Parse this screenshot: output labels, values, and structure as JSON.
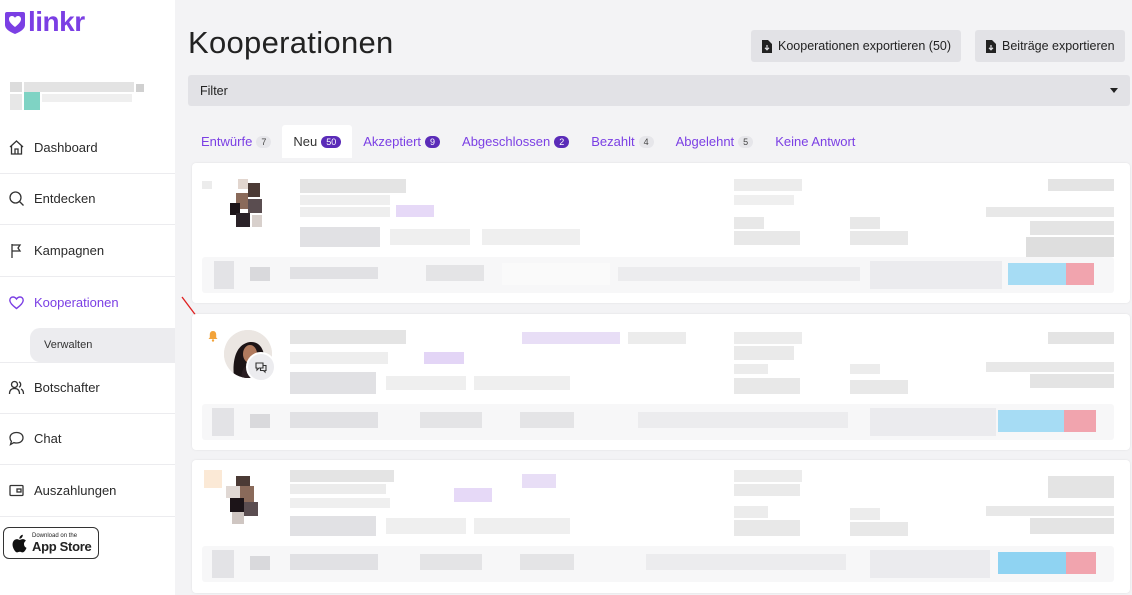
{
  "brand": {
    "name": "linkr",
    "color": "#7b3fe4"
  },
  "sidebar": {
    "items": [
      {
        "label": "Dashboard",
        "icon": "home-icon"
      },
      {
        "label": "Entdecken",
        "icon": "search-icon"
      },
      {
        "label": "Kampagnen",
        "icon": "flag-icon"
      },
      {
        "label": "Kooperationen",
        "icon": "heart-icon",
        "active": true
      },
      {
        "label": "Botschafter",
        "icon": "users-icon"
      },
      {
        "label": "Chat",
        "icon": "chat-icon"
      },
      {
        "label": "Auszahlungen",
        "icon": "wallet-icon"
      }
    ],
    "sub_item": "Verwalten",
    "appstore": {
      "small": "Download on the",
      "big": "App Store"
    }
  },
  "header": {
    "title": "Kooperationen",
    "export_coop_label": "Kooperationen exportieren (50)",
    "export_posts_label": "Beiträge exportieren"
  },
  "filter": {
    "label": "Filter"
  },
  "tabs": [
    {
      "label": "Entwürfe",
      "count": "7",
      "active": false,
      "dark": false
    },
    {
      "label": "Neu",
      "count": "50",
      "active": true,
      "dark": true
    },
    {
      "label": "Akzeptiert",
      "count": "9",
      "active": false,
      "dark": true
    },
    {
      "label": "Abgeschlossen",
      "count": "2",
      "active": false,
      "dark": true
    },
    {
      "label": "Bezahlt",
      "count": "4",
      "active": false,
      "dark": false
    },
    {
      "label": "Abgelehnt",
      "count": "5",
      "active": false,
      "dark": false
    },
    {
      "label": "Keine Antwort",
      "count": "",
      "active": false,
      "dark": false
    }
  ],
  "colors": {
    "accent": "#7b3fe4",
    "badge_dark": "#5a2bb8",
    "bell": "#f2a33a",
    "arrow": "#e02020"
  }
}
